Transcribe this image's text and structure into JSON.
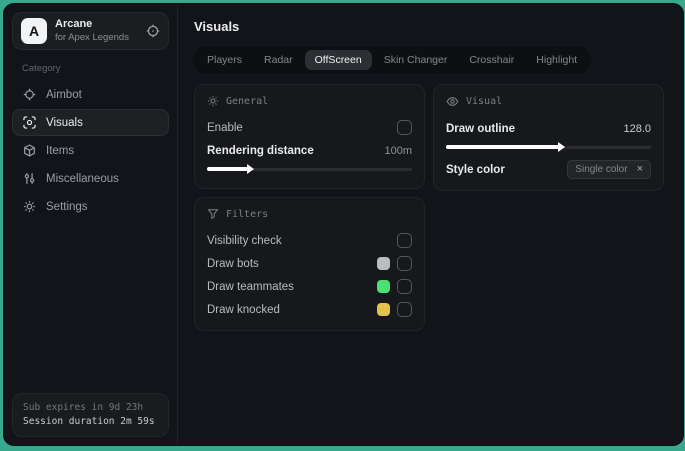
{
  "desktop_color": "#36a98e",
  "sidebar": {
    "logo_letter": "A",
    "app_name": "Arcane",
    "app_subtitle": "for Apex Legends",
    "category_label": "Category",
    "items": [
      {
        "label": "Aimbot",
        "icon": "crosshair-icon"
      },
      {
        "label": "Visuals",
        "icon": "eye-scan-icon"
      },
      {
        "label": "Items",
        "icon": "cube-icon"
      },
      {
        "label": "Miscellaneous",
        "icon": "sliders-icon"
      },
      {
        "label": "Settings",
        "icon": "gear-icon"
      }
    ],
    "selected_item": "Visuals",
    "footer": {
      "line1": "Sub expires in 9d 23h",
      "line2": "Session duration 2m 59s"
    }
  },
  "main": {
    "title": "Visuals",
    "tabs": [
      {
        "label": "Players"
      },
      {
        "label": "Radar"
      },
      {
        "label": "OffScreen"
      },
      {
        "label": "Skin Changer"
      },
      {
        "label": "Crosshair"
      },
      {
        "label": "Highlight"
      }
    ],
    "selected_tab": "OffScreen",
    "general": {
      "title": "General",
      "enable_label": "Enable",
      "enable_checked": false,
      "rendering_label": "Rendering distance",
      "rendering_value": "100m",
      "rendering_fill": "20%"
    },
    "filters": {
      "title": "Filters",
      "rows": [
        {
          "label": "Visibility check",
          "checked": false
        },
        {
          "label": "Draw bots",
          "swatch": "#b9bcc0",
          "checked": false
        },
        {
          "label": "Draw teammates",
          "swatch": "#4ade74",
          "checked": false
        },
        {
          "label": "Draw knocked",
          "swatch": "#e2c24d",
          "checked": false
        }
      ]
    },
    "visual": {
      "title": "Visual",
      "outline_label": "Draw outline",
      "outline_value": "128.0",
      "outline_fill": "55%",
      "style_label": "Style color",
      "style_value": "Single color",
      "style_clear": "×"
    }
  }
}
